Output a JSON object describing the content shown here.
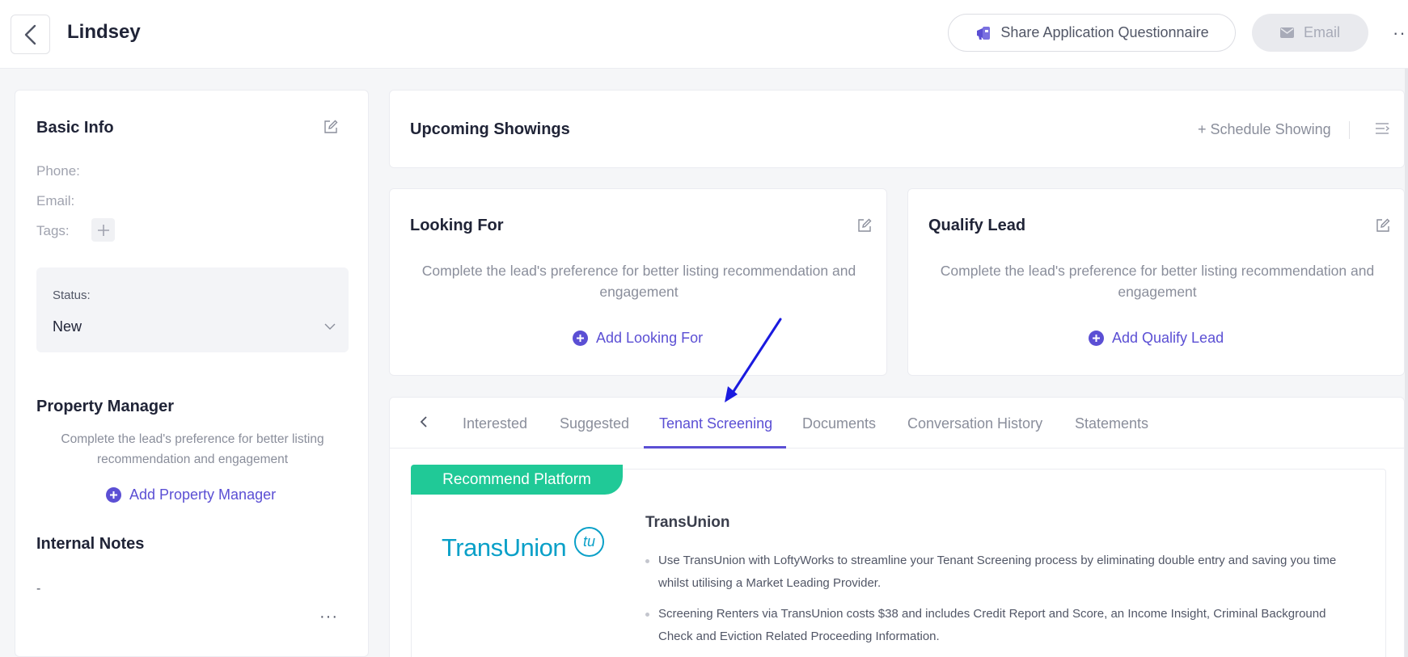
{
  "header": {
    "lead_name": "Lindsey",
    "share_label": "Share Application Questionnaire",
    "email_label": "Email",
    "more_label": "···"
  },
  "basic_info": {
    "title": "Basic Info",
    "phone_label": "Phone:",
    "email_label": "Email:",
    "tags_label": "Tags:",
    "status_label": "Status:",
    "status_value": "New"
  },
  "property_manager": {
    "title": "Property Manager",
    "hint": "Complete the lead's preference for better listing recommendation and engagement",
    "add_label": "Add Property Manager"
  },
  "internal_notes": {
    "title": "Internal Notes",
    "value": "-",
    "more_label": "···"
  },
  "showings": {
    "title": "Upcoming Showings",
    "schedule_label": "+ Schedule Showing"
  },
  "looking_for": {
    "title": "Looking For",
    "hint": "Complete the lead's preference for better listing recommendation and engagement",
    "add_label": "Add Looking For"
  },
  "qualify_lead": {
    "title": "Qualify Lead",
    "hint": "Complete the lead's preference for better listing recommendation and engagement",
    "add_label": "Add Qualify Lead"
  },
  "tabs": [
    {
      "label": "Interested",
      "active": false
    },
    {
      "label": "Suggested",
      "active": false
    },
    {
      "label": "Tenant Screening",
      "active": true
    },
    {
      "label": "Documents",
      "active": false
    },
    {
      "label": "Conversation History",
      "active": false
    },
    {
      "label": "Statements",
      "active": false
    }
  ],
  "screening": {
    "badge": "Recommend Platform",
    "logo_text": "TransUnion",
    "logo_mark": "tu",
    "platform_name": "TransUnion",
    "bullets": [
      "Use TransUnion with LoftyWorks to streamline your Tenant Screening process by eliminating double entry and saving you time whilst utilising a Market Leading Provider.",
      "Screening Renters via TransUnion costs $38 and includes Credit Report and Score, an Income Insight, Criminal Background Check and Eviction Related Proceeding Information."
    ]
  },
  "colors": {
    "accent": "#5b4fd4",
    "badge": "#20c997",
    "transunion": "#0aa0c8",
    "annotation": "#1a1adf"
  },
  "icons": [
    "back-arrow-icon",
    "megaphone-icon",
    "mail-icon",
    "edit-icon",
    "plus-icon",
    "chevron-down-icon",
    "plus-circle-icon",
    "list-icon",
    "chevron-left-icon",
    "annotation-arrow-icon"
  ]
}
